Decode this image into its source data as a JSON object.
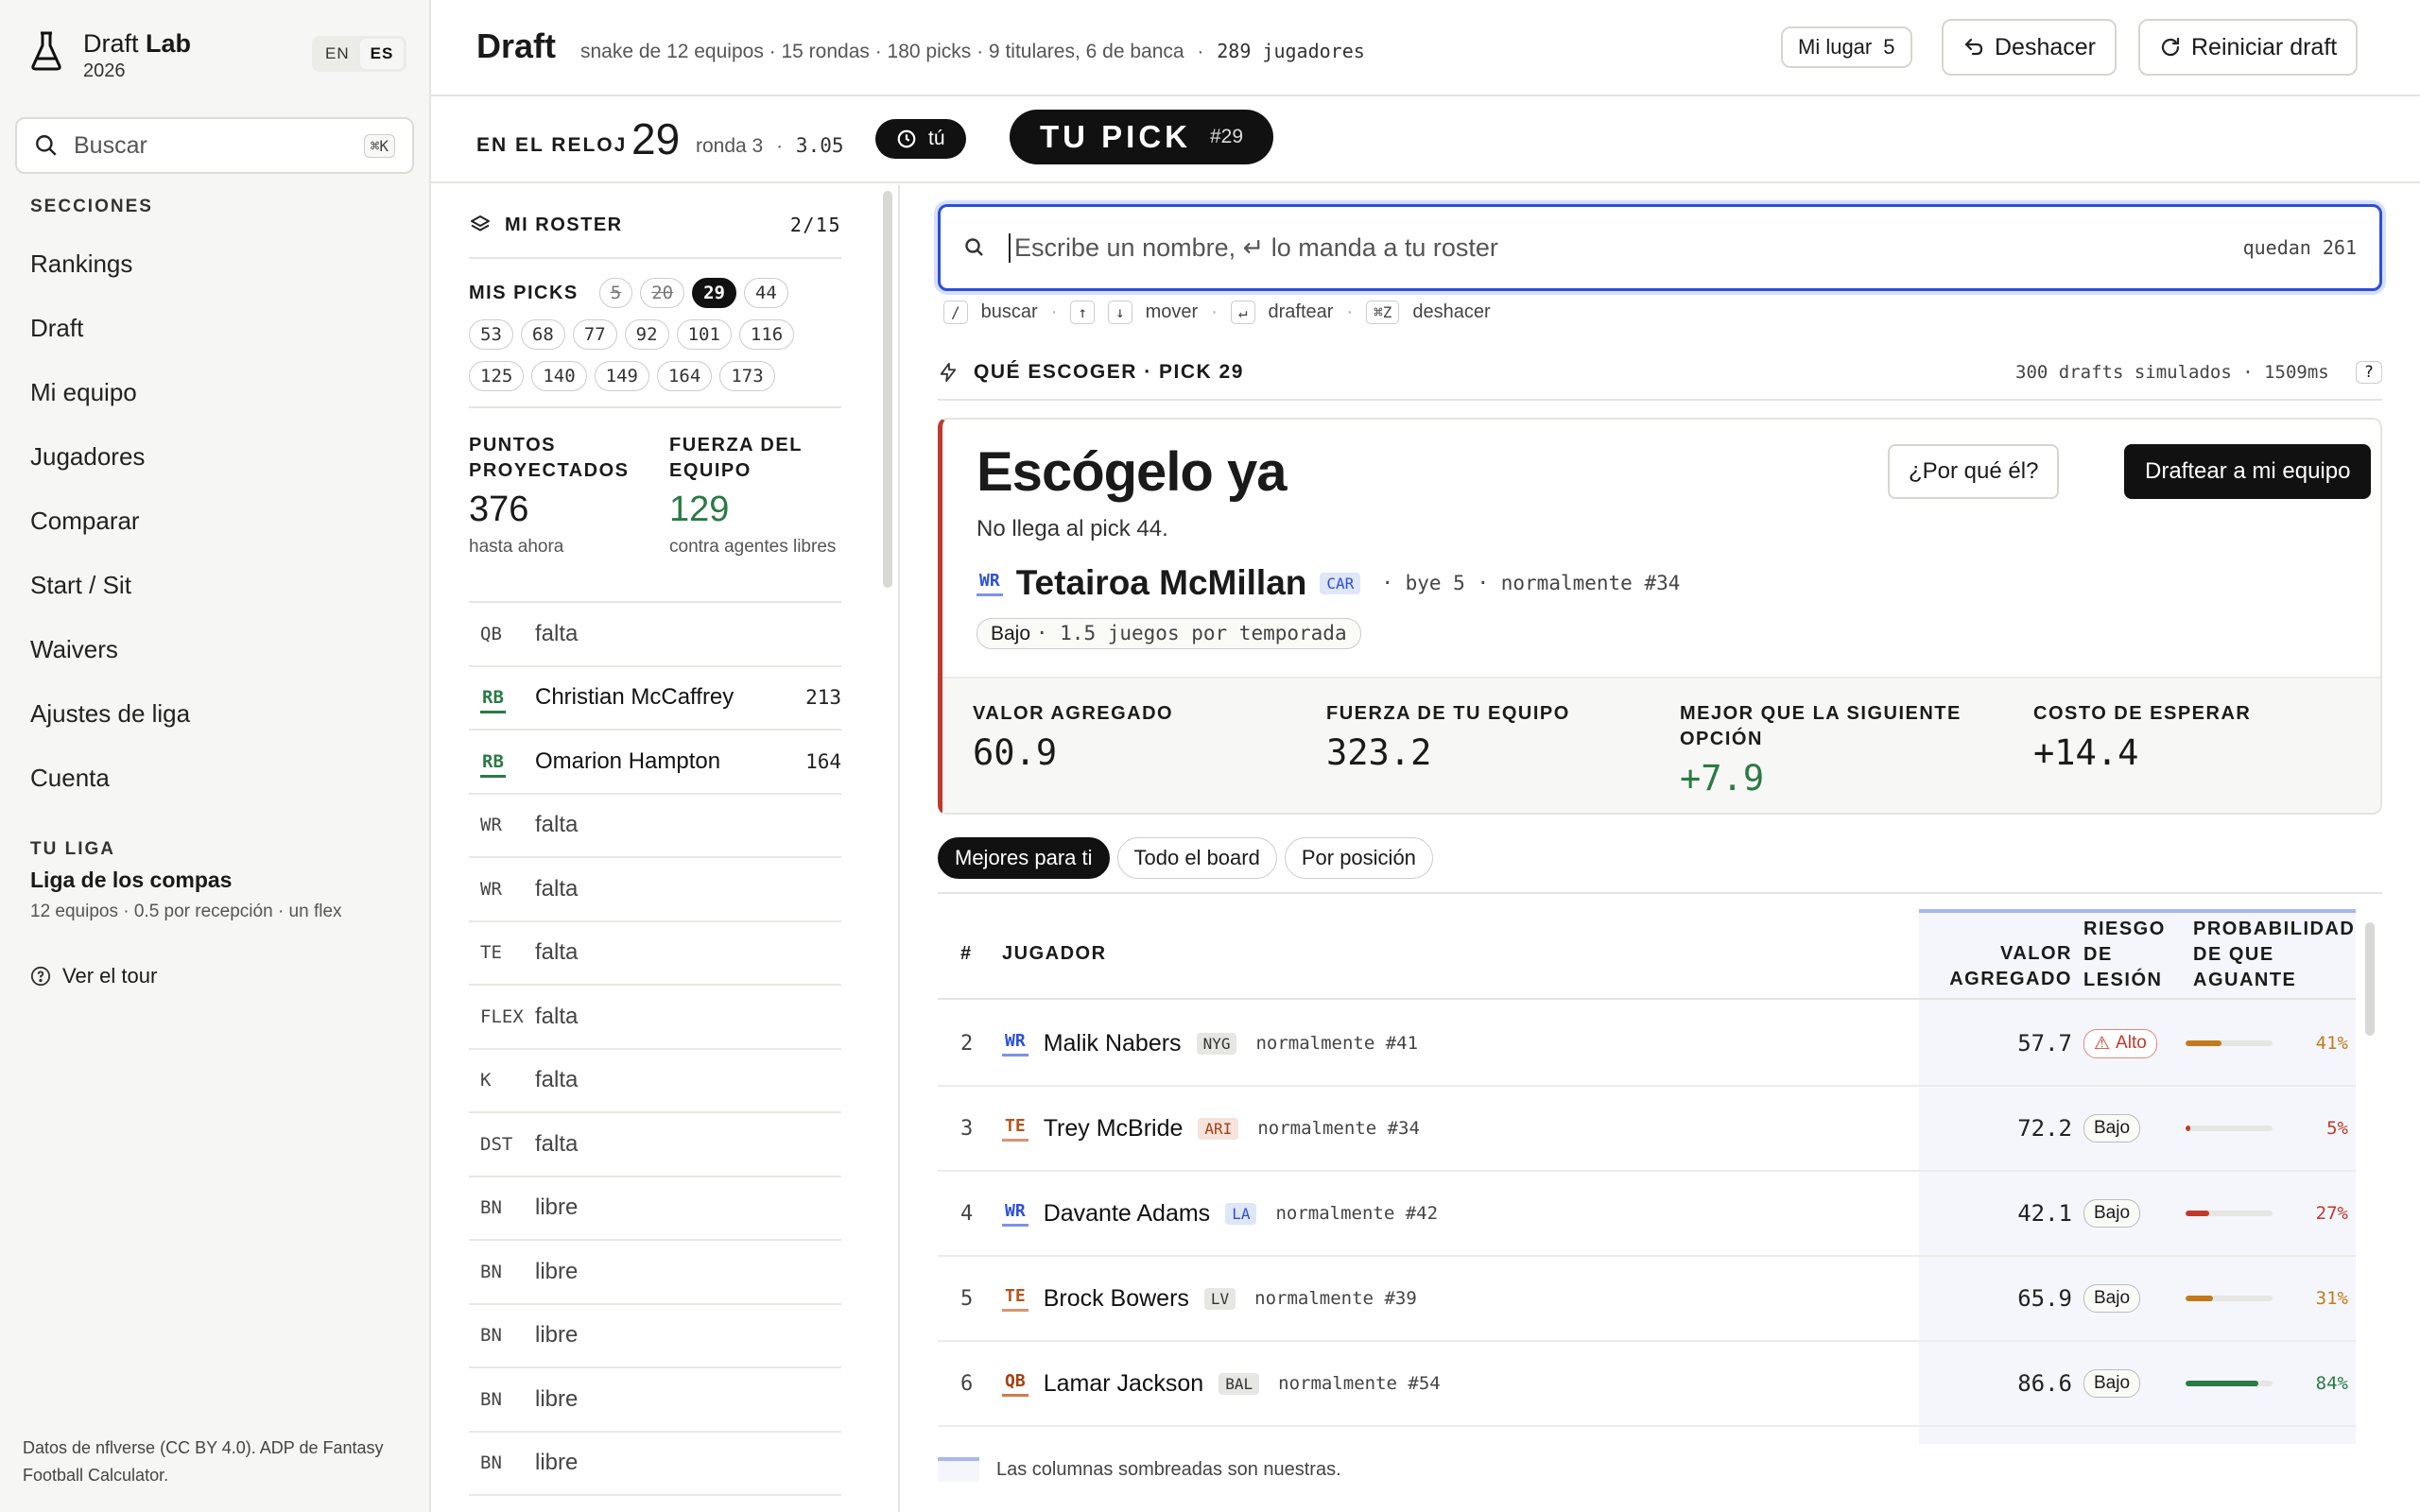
{
  "sidebar": {
    "brand_first": "Draft",
    "brand_second": "Lab",
    "year": "2026",
    "lang": [
      "EN",
      "ES"
    ],
    "lang_selected": "ES",
    "search_placeholder": "Buscar",
    "search_shortcut": "⌘K",
    "sections_heading": "SECCIONES",
    "nav": [
      "Rankings",
      "Draft",
      "Mi equipo",
      "Jugadores",
      "Comparar",
      "Start / Sit",
      "Waivers",
      "Ajustes de liga",
      "Cuenta"
    ],
    "league_heading": "TU LIGA",
    "league_name": "Liga de los compas",
    "league_desc": "12 equipos · 0.5 por recepción · un flex",
    "tour": "Ver el tour",
    "credits": "Datos de nflverse (CC BY 4.0). ADP de Fantasy Football Calculator."
  },
  "header": {
    "title": "Draft",
    "subtitle": "snake de 12 equipos · 15 rondas · 180 picks · 9 titulares, 6 de banca",
    "sep": "·",
    "players_count": "289 jugadores",
    "my_spot_label": "Mi lugar",
    "my_spot_value": "5",
    "undo": "Deshacer",
    "reset": "Reiniciar draft"
  },
  "clock": {
    "label": "EN EL RELOJ",
    "pick": "29",
    "round": "ronda 3",
    "sep": "·",
    "round_pick": "3.05",
    "badge": "tú",
    "your_pick": "TU PICK",
    "your_pick_num": "#29"
  },
  "roster": {
    "heading": "MI ROSTER",
    "count": "2/15",
    "picks_label": "MIS PICKS",
    "picks_rows": [
      [
        {
          "n": "5",
          "s": "past"
        },
        {
          "n": "20",
          "s": "past"
        },
        {
          "n": "29",
          "s": "cur"
        },
        {
          "n": "44",
          "s": ""
        }
      ],
      [
        {
          "n": "53",
          "s": ""
        },
        {
          "n": "68",
          "s": ""
        },
        {
          "n": "77",
          "s": ""
        },
        {
          "n": "92",
          "s": ""
        },
        {
          "n": "101",
          "s": ""
        },
        {
          "n": "116",
          "s": ""
        }
      ],
      [
        {
          "n": "125",
          "s": ""
        },
        {
          "n": "140",
          "s": ""
        },
        {
          "n": "149",
          "s": ""
        },
        {
          "n": "164",
          "s": ""
        },
        {
          "n": "173",
          "s": ""
        }
      ]
    ],
    "projected_label": "PUNTOS PROYECTADOS",
    "projected_value": "376",
    "projected_sub": "hasta ahora",
    "strength_label": "FUERZA DEL EQUIPO",
    "strength_value": "129",
    "strength_sub": "contra agentes libres",
    "slots": [
      {
        "pos": "QB",
        "name": "falta",
        "pts": "",
        "filled": false
      },
      {
        "pos": "RB",
        "name": "Christian McCaffrey",
        "pts": "213",
        "filled": true
      },
      {
        "pos": "RB",
        "name": "Omarion Hampton",
        "pts": "164",
        "filled": true
      },
      {
        "pos": "WR",
        "name": "falta",
        "pts": "",
        "filled": false
      },
      {
        "pos": "WR",
        "name": "falta",
        "pts": "",
        "filled": false
      },
      {
        "pos": "TE",
        "name": "falta",
        "pts": "",
        "filled": false
      },
      {
        "pos": "FLEX",
        "name": "falta",
        "pts": "",
        "filled": false
      },
      {
        "pos": "K",
        "name": "falta",
        "pts": "",
        "filled": false
      },
      {
        "pos": "DST",
        "name": "falta",
        "pts": "",
        "filled": false
      },
      {
        "pos": "BN",
        "name": "libre",
        "pts": "",
        "filled": false
      },
      {
        "pos": "BN",
        "name": "libre",
        "pts": "",
        "filled": false
      },
      {
        "pos": "BN",
        "name": "libre",
        "pts": "",
        "filled": false
      },
      {
        "pos": "BN",
        "name": "libre",
        "pts": "",
        "filled": false
      },
      {
        "pos": "BN",
        "name": "libre",
        "pts": "",
        "filled": false
      }
    ]
  },
  "main": {
    "search_placeholder": "Escribe un nombre, ↵ lo manda a tu roster",
    "remaining": "quedan 261",
    "hints": [
      {
        "key": "/",
        "label": "buscar"
      },
      {
        "key": "↑",
        "key2": "↓",
        "label": "mover"
      },
      {
        "key": "↵",
        "label": "draftear"
      },
      {
        "key": "⌘Z",
        "label": "deshacer"
      }
    ],
    "recommend_heading": "QUÉ ESCOGER · PICK 29",
    "sim_info": "300 drafts simulados · 1509ms",
    "help": "?",
    "card": {
      "title": "Escógelo ya",
      "reason": "No llega al pick 44.",
      "pos": "WR",
      "player": "Tetairoa McMillan",
      "team": "CAR",
      "meta": "· bye 5 · normalmente #34",
      "risk": "Bajo",
      "risk_detail": "· 1.5 juegos por temporada",
      "why_button": "¿Por qué él?",
      "draft_button": "Draftear a mi equipo",
      "metrics": [
        {
          "label": "VALOR AGREGADO",
          "value": "60.9",
          "positive": false
        },
        {
          "label": "FUERZA DE TU EQUIPO",
          "value": "323.2",
          "positive": false
        },
        {
          "label": "MEJOR QUE LA SIGUIENTE OPCIÓN",
          "value": "+7.9",
          "positive": true
        },
        {
          "label": "COSTO DE ESPERAR",
          "value": "+14.4",
          "positive": false
        }
      ]
    },
    "tabs": [
      "Mejores para ti",
      "Todo el board",
      "Por posición"
    ],
    "tab_selected": 0,
    "table": {
      "headers": [
        "#",
        "JUGADOR",
        "VALOR AGREGADO",
        "RIESGO DE LESIÓN",
        "PROBABILIDAD DE QUE AGUANTE"
      ],
      "rows": [
        {
          "rank": "2",
          "pos": "WR",
          "name": "Malik Nabers",
          "team": "NYG",
          "usual": "normalmente #41",
          "value": "57.7",
          "risk": "Alto",
          "prob": 41,
          "prob_text": "41%",
          "color": "#c47a1a"
        },
        {
          "rank": "3",
          "pos": "TE",
          "name": "Trey McBride",
          "team": "ARI",
          "usual": "normalmente #34",
          "value": "72.2",
          "risk": "Bajo",
          "prob": 5,
          "prob_text": "5%",
          "color": "#c0392b"
        },
        {
          "rank": "4",
          "pos": "WR",
          "name": "Davante Adams",
          "team": "LA",
          "usual": "normalmente #42",
          "value": "42.1",
          "risk": "Bajo",
          "prob": 27,
          "prob_text": "27%",
          "color": "#c0392b"
        },
        {
          "rank": "5",
          "pos": "TE",
          "name": "Brock Bowers",
          "team": "LV",
          "usual": "normalmente #39",
          "value": "65.9",
          "risk": "Bajo",
          "prob": 31,
          "prob_text": "31%",
          "color": "#c47a1a"
        },
        {
          "rank": "6",
          "pos": "QB",
          "name": "Lamar Jackson",
          "team": "BAL",
          "usual": "normalmente #54",
          "value": "86.6",
          "risk": "Bajo",
          "prob": 84,
          "prob_text": "84%",
          "color": "#2a7a45"
        }
      ]
    },
    "footnote": "Las columnas sombreadas son nuestras."
  },
  "colors": {
    "accent_blue": "#2c4fd8",
    "positive": "#2a7a45",
    "danger": "#c0392b",
    "warning": "#c47a1a"
  }
}
